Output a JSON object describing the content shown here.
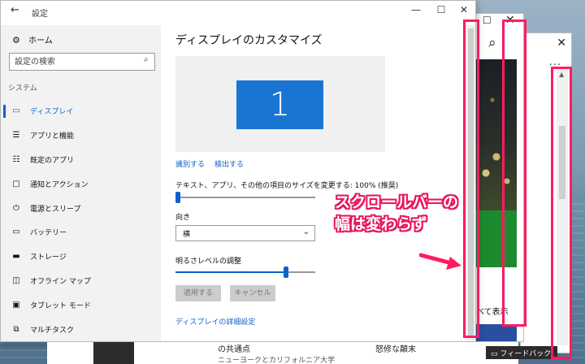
{
  "window": {
    "title": "設定",
    "back_icon": "←",
    "minimize_icon": "—",
    "maximize_icon": "☐",
    "close_icon": "✕"
  },
  "sidebar": {
    "home_label": "ホーム",
    "search_placeholder": "設定の検索",
    "section_label": "システム",
    "items": [
      {
        "label": "ディスプレイ",
        "icon": "monitor-icon",
        "active": true
      },
      {
        "label": "アプリと機能",
        "icon": "list-icon",
        "active": false
      },
      {
        "label": "既定のアプリ",
        "icon": "list-check-icon",
        "active": false
      },
      {
        "label": "通知とアクション",
        "icon": "notification-icon",
        "active": false
      },
      {
        "label": "電源とスリープ",
        "icon": "power-icon",
        "active": false
      },
      {
        "label": "バッテリー",
        "icon": "battery-icon",
        "active": false
      },
      {
        "label": "ストレージ",
        "icon": "storage-icon",
        "active": false
      },
      {
        "label": "オフライン マップ",
        "icon": "map-icon",
        "active": false
      },
      {
        "label": "タブレット モード",
        "icon": "tablet-icon",
        "active": false
      },
      {
        "label": "マルチタスク",
        "icon": "multitask-icon",
        "active": false
      }
    ]
  },
  "main": {
    "heading": "ディスプレイのカスタマイズ",
    "monitor_number": "1",
    "identify_link": "識別する",
    "detect_link": "検出する",
    "scale_label": "テキスト、アプリ、その他の項目のサイズを変更する: 100% (推奨)",
    "scale_level": 0,
    "orientation_label": "向き",
    "orientation_value": "横",
    "brightness_label": "明るさレベルの調整",
    "brightness_level": 0.79,
    "apply_button": "適用する",
    "cancel_button": "キャンセル",
    "advanced_link": "ディスプレイの詳細設定"
  },
  "back_window": {
    "show_all": "べて表示",
    "more_icon": "···"
  },
  "bottom": {
    "text1": "の共通点",
    "text2": "ニューヨークとカリフォルニア大学",
    "text3": "怒修な顛末",
    "feedback": "フィードバック"
  },
  "annotation": {
    "line1": "スクロールバーの",
    "line2": "幅は変わらず",
    "color": "#ff1c60"
  },
  "colors": {
    "accent": "#0a62c9",
    "monitor": "#1876d2"
  }
}
